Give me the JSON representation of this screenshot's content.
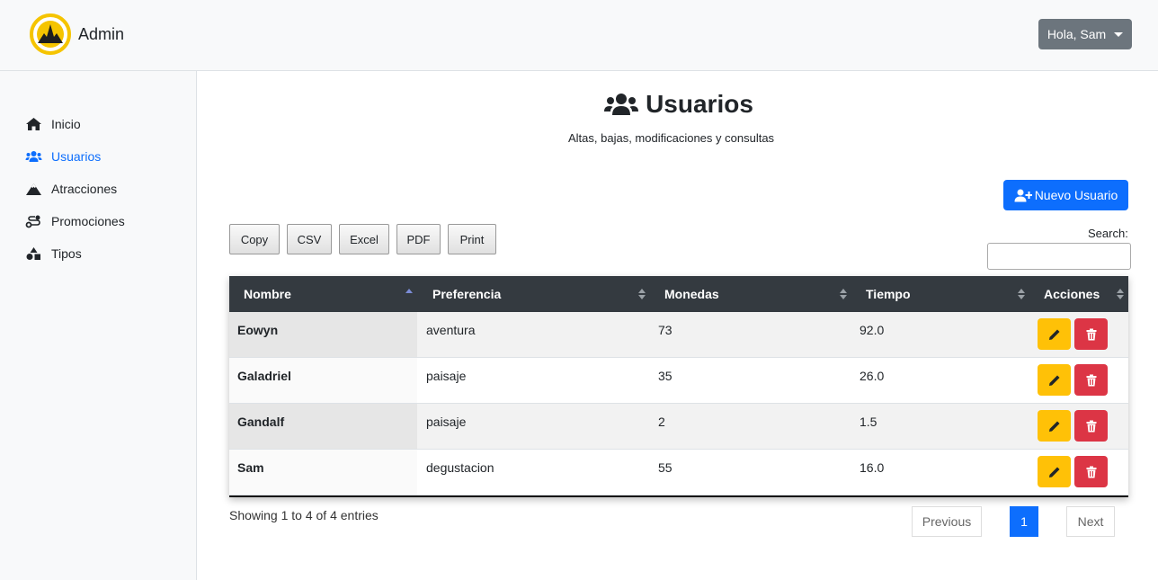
{
  "brand": {
    "name": "Admin"
  },
  "user_menu": {
    "label": "Hola, Sam"
  },
  "sidebar": {
    "items": [
      {
        "label": "Inicio",
        "icon": "home-icon",
        "active": false
      },
      {
        "label": "Usuarios",
        "icon": "users-icon",
        "active": true
      },
      {
        "label": "Atracciones",
        "icon": "mountain-icon",
        "active": false
      },
      {
        "label": "Promociones",
        "icon": "route-icon",
        "active": false
      },
      {
        "label": "Tipos",
        "icon": "shapes-icon",
        "active": false
      }
    ]
  },
  "page": {
    "title": "Usuarios",
    "subtitle": "Altas, bajas, modificaciones y consultas",
    "new_button": "Nuevo Usuario"
  },
  "export_buttons": [
    "Copy",
    "CSV",
    "Excel",
    "PDF",
    "Print"
  ],
  "search": {
    "label": "Search:",
    "value": ""
  },
  "table": {
    "columns": [
      "Nombre",
      "Preferencia",
      "Monedas",
      "Tiempo",
      "Acciones"
    ],
    "rows": [
      {
        "nombre": "Eowyn",
        "preferencia": "aventura",
        "monedas": "73",
        "tiempo": "92.0"
      },
      {
        "nombre": "Galadriel",
        "preferencia": "paisaje",
        "monedas": "35",
        "tiempo": "26.0"
      },
      {
        "nombre": "Gandalf",
        "preferencia": "paisaje",
        "monedas": "2",
        "tiempo": "1.5"
      },
      {
        "nombre": "Sam",
        "preferencia": "degustacion",
        "monedas": "55",
        "tiempo": "16.0"
      }
    ]
  },
  "footer": {
    "info": "Showing 1 to 4 of 4 entries",
    "previous": "Previous",
    "current_page": "1",
    "next": "Next"
  },
  "colors": {
    "primary": "#0d6efd",
    "warning": "#ffc107",
    "danger": "#dc3545",
    "secondary": "#6c757d",
    "table_header": "#343a40"
  }
}
